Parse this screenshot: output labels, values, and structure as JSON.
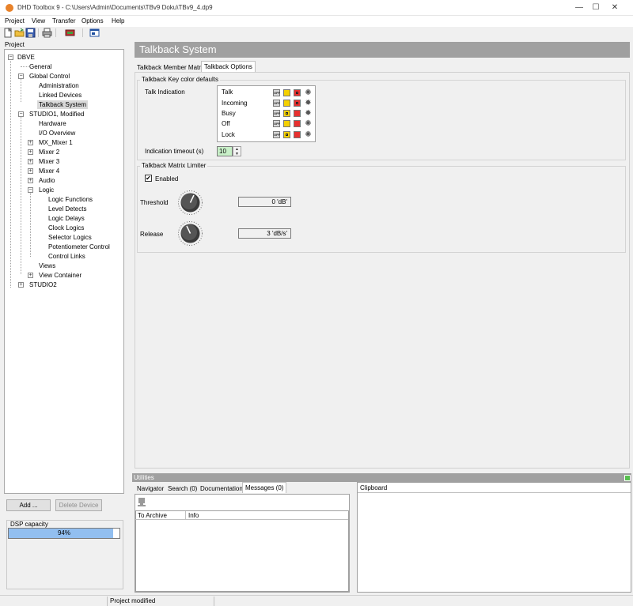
{
  "window": {
    "title": "DHD Toolbox 9 - C:\\Users\\Admin\\Documents\\TBv9 Doku\\TBv9_4.dp9",
    "minimize": "—",
    "maximize": "☐",
    "close": "✕"
  },
  "menu": [
    "Project",
    "View",
    "Transfer",
    "Options",
    "Help"
  ],
  "toolbar": {
    "icons": [
      "new-file-icon",
      "open-folder-icon",
      "save-icon",
      "print-icon",
      "connect-device-icon",
      "settings-window-icon"
    ]
  },
  "project_panel": {
    "label": "Project",
    "tree": [
      {
        "label": "DBVE",
        "expander": "−"
      },
      {
        "label": "General"
      },
      {
        "label": "Global Control",
        "expander": "−"
      },
      {
        "label": "Administration"
      },
      {
        "label": "Linked Devices"
      },
      {
        "label": "Talkback System",
        "selected": true
      },
      {
        "label": "STUDIO1, Modified",
        "expander": "−"
      },
      {
        "label": "Hardware"
      },
      {
        "label": "I/O Overview"
      },
      {
        "label": "MX_Mixer 1",
        "expander": "+"
      },
      {
        "label": "Mixer 2",
        "expander": "+"
      },
      {
        "label": "Mixer 3",
        "expander": "+"
      },
      {
        "label": "Mixer 4",
        "expander": "+"
      },
      {
        "label": "Audio",
        "expander": "+"
      },
      {
        "label": "Logic",
        "expander": "−"
      },
      {
        "label": "Logic Functions"
      },
      {
        "label": "Level Detects"
      },
      {
        "label": "Logic Delays"
      },
      {
        "label": "Clock Logics"
      },
      {
        "label": "Selector Logics"
      },
      {
        "label": "Potentiometer Control"
      },
      {
        "label": "Control Links"
      },
      {
        "label": "Views"
      },
      {
        "label": "View Container",
        "expander": "+"
      },
      {
        "label": "STUDIO2",
        "expander": "+"
      }
    ],
    "add_button": "Add ...",
    "delete_button": "Delete Device",
    "dsp": {
      "label": "DSP capacity",
      "value_text": "94%",
      "fraction": 0.94
    }
  },
  "main": {
    "title": "Talkback System",
    "tabs": [
      "Talkback Member Matrix",
      "Talkback Options"
    ],
    "active_tab": 1,
    "key_colors": {
      "group_title": "Talkback Key color defaults",
      "talk_indication_label": "Talk Indication",
      "rows": [
        {
          "label": "Talk",
          "mode": "OFF",
          "left": "yellow",
          "right_marked": true,
          "blink": false
        },
        {
          "label": "Incoming",
          "mode": "OFF",
          "left": "yellow",
          "right_marked": true,
          "blink": true
        },
        {
          "label": "Busy",
          "mode": "OFF",
          "left_marked": true,
          "left": "yellow",
          "right": "red",
          "blink": true
        },
        {
          "label": "Off",
          "mode": "OFF",
          "left": "yellow",
          "right": "red",
          "blink": false
        },
        {
          "label": "Lock",
          "mode": "OFF",
          "left_marked": true,
          "left": "yellow",
          "right": "red",
          "blink": false
        }
      ],
      "timeout_label": "Indication timeout (s)",
      "timeout_value": "10"
    },
    "limiter": {
      "group_title": "Talkback Matrix Limiter",
      "enabled_label": "Enabled",
      "enabled_check": "✔",
      "threshold_label": "Threshold",
      "threshold_value": "0 'dB'",
      "release_label": "Release",
      "release_value": "3 'dB/s'"
    }
  },
  "utilities": {
    "title": "Utilities",
    "tabs": [
      "Navigator",
      "Search (0)",
      "Documentation",
      "Messages (0)"
    ],
    "active_tab": 3,
    "columns": [
      "To Archive",
      "Info"
    ],
    "clipboard_title": "Clipboard"
  },
  "status": {
    "text": "Project modified"
  },
  "colors": {
    "accent_header": "#a0a0a0",
    "yellow": "#f4d000",
    "red": "#e73030",
    "input_green": "#c8f0c8",
    "dsp_fill": "#92bff0"
  }
}
